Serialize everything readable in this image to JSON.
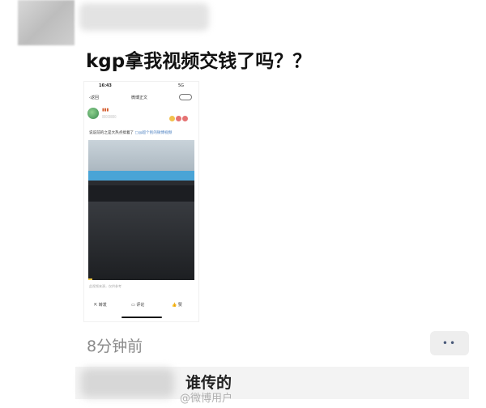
{
  "post": {
    "text": "kgp拿我视频交钱了吗？？"
  },
  "screenshot": {
    "status": {
      "time": "16:43",
      "signal": "5G"
    },
    "nav": {
      "back_label": "返回",
      "title": "微博正文"
    },
    "caption": "说说前的之是大热点搞着了",
    "caption_link": "□@超个别的微博视频",
    "video_note": "此视频来源，仅供参考",
    "actions": {
      "repost": "转发",
      "comment": "评论",
      "like": "赞"
    },
    "progress": 0.04
  },
  "meta": {
    "time_ago": "8分钟前",
    "more_label": "••"
  },
  "reply": {
    "text": "谁传的"
  },
  "watermark": {
    "text": "@微博用户"
  },
  "colors": {
    "video_stripe": "#4aa4d6",
    "progress": "#f0c94a",
    "reply_bg": "#f3f3f3"
  }
}
